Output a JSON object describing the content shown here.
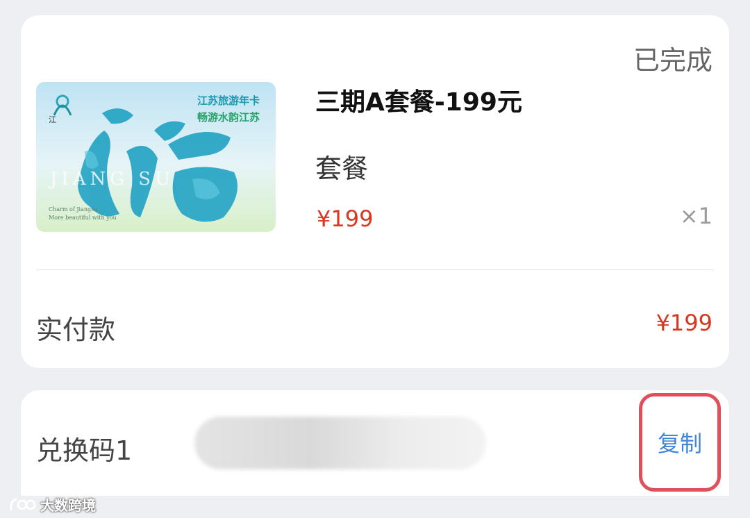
{
  "order": {
    "status": "已完成",
    "product": {
      "title": "三期A套餐-199元",
      "type": "套餐",
      "price": "¥199",
      "quantity": "×1",
      "image": {
        "heading_line1": "江苏旅游年卡",
        "heading_line2": "畅游水韵江苏",
        "big_calligraphy": "江苏",
        "pinyin": "JIANG SU",
        "tagline_line1": "Charm of Jiangsu",
        "tagline_line2": "More beautiful with you"
      }
    },
    "paid_label": "实付款",
    "paid_amount": "¥199"
  },
  "redeem": {
    "label": "兑换码1",
    "copy_label": "复制"
  },
  "watermark": {
    "text": "大数跨境"
  },
  "colors": {
    "price_red": "#d9361f",
    "link_blue": "#3f86d8",
    "highlight_red": "#e0505a",
    "background": "#eeeff2"
  }
}
